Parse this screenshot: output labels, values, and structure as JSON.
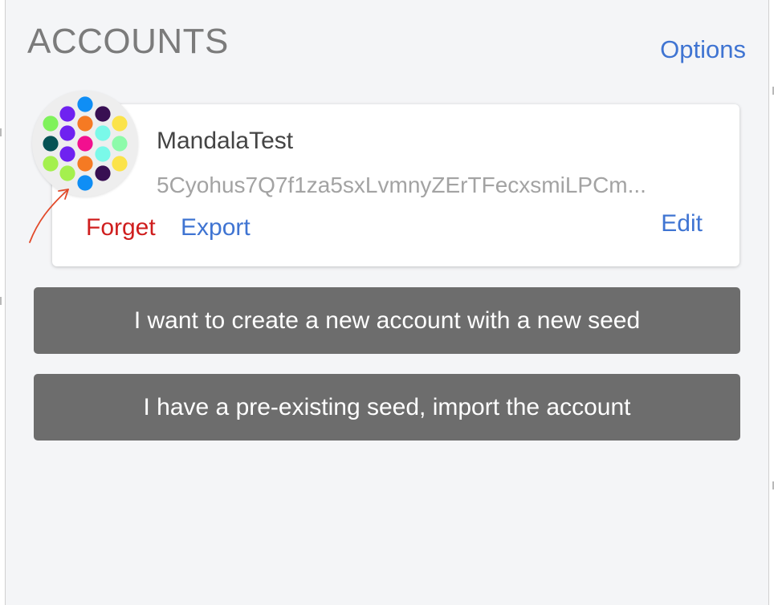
{
  "header": {
    "title": "ACCOUNTS",
    "options_label": "Options"
  },
  "account": {
    "name": "MandalaTest",
    "address": "5Cyohus7Q7f1za5sxLvmnyZErTFecxsmiLPCm...",
    "forget_label": "Forget",
    "export_label": "Export",
    "edit_label": "Edit",
    "identicon_colors": [
      "#0f8ef5",
      "#6f22f0",
      "#7ff25b",
      "#380f52",
      "#fbe34a",
      "#f57a23",
      "#7af9e9",
      "#065355",
      "#f20f8f",
      "#8dfbaa",
      "#a4f04e"
    ]
  },
  "actions": {
    "create_label": "I want to create a new account with a new seed",
    "import_label": "I have a pre-existing seed, import the account"
  },
  "colors": {
    "link": "#3f74d2",
    "danger": "#cf1e1e",
    "button_bg": "#6d6d6d",
    "popup_bg": "#f4f5f7",
    "annotation_arrow": "#e24a2a"
  }
}
